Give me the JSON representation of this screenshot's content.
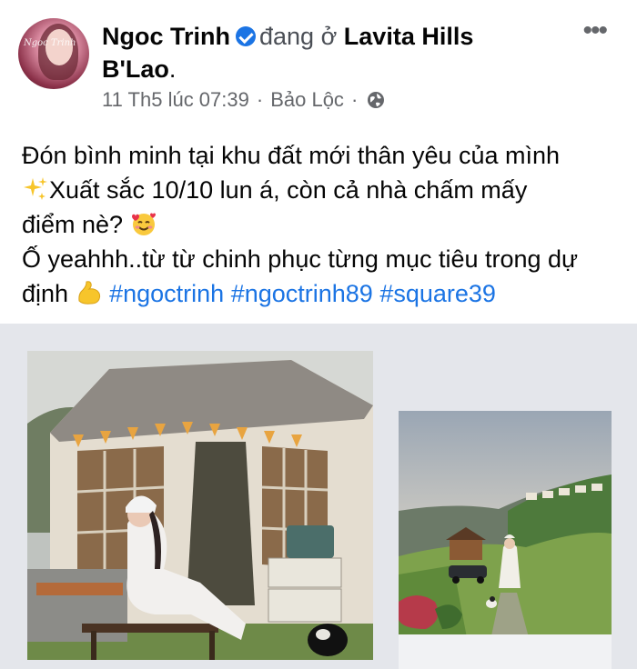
{
  "post": {
    "author": "Ngoc Trinh",
    "status_prefix": "đang ở",
    "place_line1": "Lavita Hills",
    "place_line2": "B'Lao",
    "place_end": ".",
    "date": "11 Th5 lúc 07:39",
    "location": "Bảo Lộc",
    "separator": "·",
    "more_label": "•••",
    "avatar_signature": "Ngoc Trinh"
  },
  "caption": {
    "line1": "Đón bình minh tại khu đất mới thân yêu của mình",
    "line2": "Xuất sắc 10/10 lun á, còn cả nhà chấm mấy",
    "line3": "điểm nè?",
    "line4": "Ố yeahhh..từ từ chinh phục từng mục tiêu trong dự",
    "line5_start": "định",
    "hashtags": [
      "#ngoctrinh",
      "#ngoctrinh89",
      "#square39"
    ]
  },
  "colors": {
    "link": "#1b74e4",
    "secondary_text": "#65676b",
    "gallery_bg": "#e4e6eb"
  },
  "icons": {
    "verified": "verified-badge-icon",
    "globe": "globe-icon",
    "sparkles": "sparkles-emoji",
    "smiling_hearts": "smiling-face-with-hearts-emoji",
    "flexed_bicep": "flexed-biceps-emoji"
  }
}
